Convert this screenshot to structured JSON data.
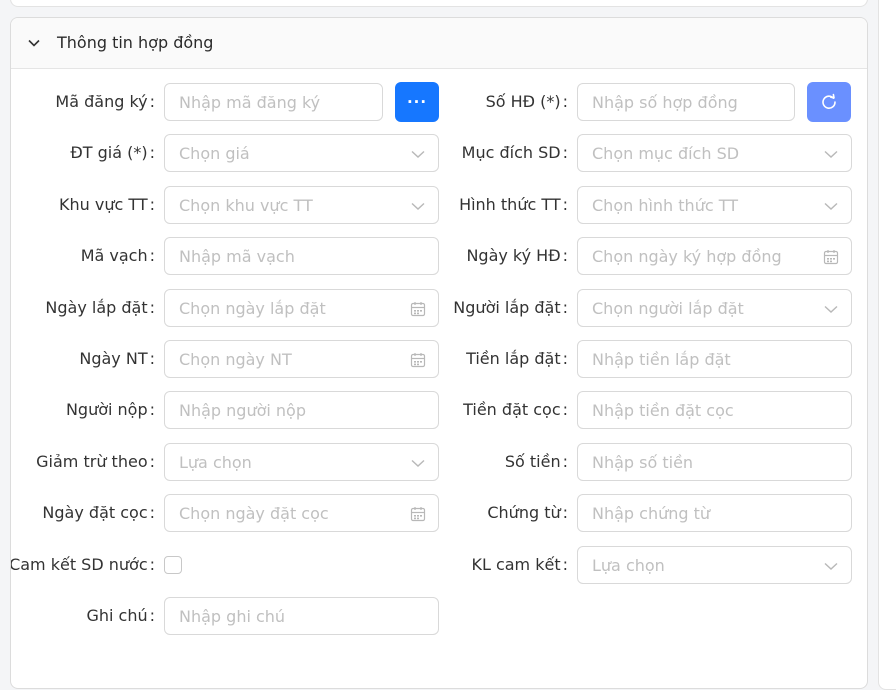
{
  "panel": {
    "title": "Thông tin hợp đồng"
  },
  "left_fields": [
    {
      "label": "Mã đăng ký",
      "placeholder": "Nhập mã đăng ký",
      "type": "text"
    },
    {
      "label": "ĐT giá (*)",
      "placeholder": "Chọn giá",
      "type": "select"
    },
    {
      "label": "Khu vực TT",
      "placeholder": "Chọn khu vực TT",
      "type": "select"
    },
    {
      "label": "Mã vạch",
      "placeholder": "Nhập mã vạch",
      "type": "text"
    },
    {
      "label": "Ngày lắp đặt",
      "placeholder": "Chọn ngày lắp đặt",
      "type": "date"
    },
    {
      "label": "Ngày NT",
      "placeholder": "Chọn ngày NT",
      "type": "date"
    },
    {
      "label": "Người nộp",
      "placeholder": "Nhập người nộp",
      "type": "text"
    },
    {
      "label": "Giảm trừ theo",
      "placeholder": "Lựa chọn",
      "type": "select"
    },
    {
      "label": "Ngày đặt cọc",
      "placeholder": "Chọn ngày đặt cọc",
      "type": "date"
    },
    {
      "label": "Cam kết SD nước",
      "type": "checkbox"
    },
    {
      "label": "Ghi chú",
      "placeholder": "Nhập ghi chú",
      "type": "text"
    }
  ],
  "right_fields": [
    {
      "label": "Số HĐ (*)",
      "placeholder": "Nhập số hợp đồng",
      "type": "text"
    },
    {
      "label": "Mục đích SD",
      "placeholder": "Chọn mục đích SD",
      "type": "select"
    },
    {
      "label": "Hình thức TT",
      "placeholder": "Chọn hình thức TT",
      "type": "select"
    },
    {
      "label": "Ngày ký HĐ",
      "placeholder": "Chọn ngày ký hợp đồng",
      "type": "date"
    },
    {
      "label": "Người lắp đặt",
      "placeholder": "Chọn người lắp đặt",
      "type": "select"
    },
    {
      "label": "Tiền lắp đặt",
      "placeholder": "Nhập tiền lắp đặt",
      "type": "text"
    },
    {
      "label": "Tiền đặt cọc",
      "placeholder": "Nhập tiền đặt cọc",
      "type": "text"
    },
    {
      "label": "Số tiền",
      "placeholder": "Nhập số tiền",
      "type": "text"
    },
    {
      "label": "Chứng từ",
      "placeholder": "Nhập chứng từ",
      "type": "text"
    },
    {
      "label": "KL cam kết",
      "placeholder": "Lựa chọn",
      "type": "select"
    }
  ],
  "buttons": {
    "more_label": "...",
    "more_icon": "ellipsis-icon",
    "refresh_icon": "refresh-icon"
  },
  "colors": {
    "primary": "#1677ff",
    "refresh_button": "#6a90ff",
    "placeholder": "#c0c0c0",
    "border": "#d9d9d9"
  }
}
